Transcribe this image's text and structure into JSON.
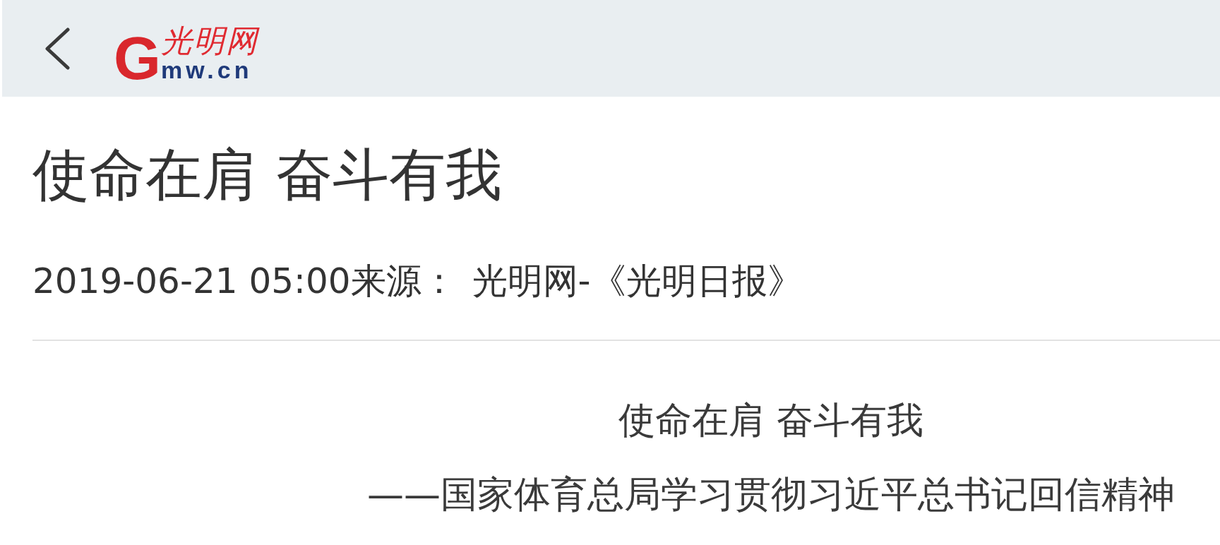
{
  "header": {
    "logo": {
      "initial": "G",
      "calligraphy": "光明网",
      "domain": "mw.cn"
    }
  },
  "article": {
    "title": "使命在肩 奋斗有我",
    "date": "2019-06-21 05:00",
    "source_label": "来源：",
    "source": "光明网-《光明日报》",
    "body_lines": [
      "使命在肩 奋斗有我",
      "——国家体育总局学习贯彻习近平总书记回信精神"
    ]
  }
}
